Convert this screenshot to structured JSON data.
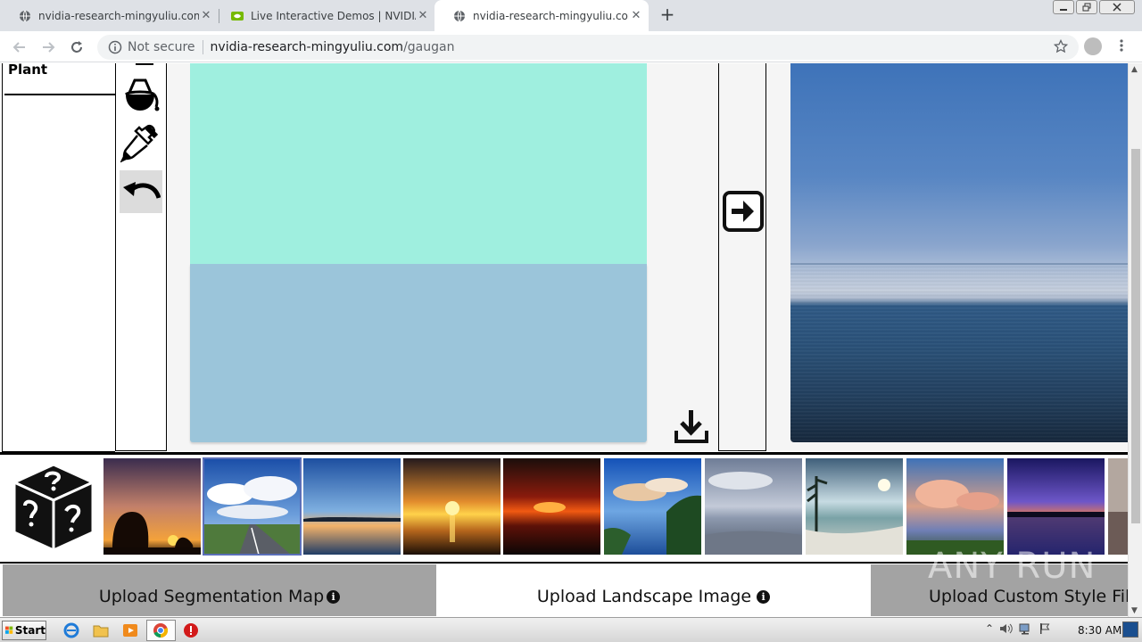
{
  "browser": {
    "tabs": [
      {
        "label": "nvidia-research-mingyuliu.com",
        "close": "✕",
        "active": false
      },
      {
        "label": "Live Interactive Demos | NVIDIA Res",
        "close": "✕",
        "active": false
      },
      {
        "label": "nvidia-research-mingyuliu.com",
        "close": "✕",
        "active": true
      }
    ],
    "new_tab": "+",
    "security_text": "Not secure",
    "url_host": "nvidia-research-mingyuliu.com",
    "url_path": "/gaugan"
  },
  "page": {
    "label_panel": {
      "current_label": "Plant"
    },
    "tools": [
      "brush-icon",
      "fill-bucket-icon",
      "eyedropper-icon",
      "undo-icon"
    ],
    "segmentation_colors": {
      "sky": "#9fefdf",
      "sea": "#9bc5da"
    },
    "gallery": {
      "thumbnails": [
        {
          "name": "sunset-trees",
          "selected": false
        },
        {
          "name": "road-clouds",
          "selected": true
        },
        {
          "name": "lake-dusk",
          "selected": false
        },
        {
          "name": "golden-sunset-sea",
          "selected": false
        },
        {
          "name": "red-sunset",
          "selected": false
        },
        {
          "name": "cliff-coast",
          "selected": false
        },
        {
          "name": "cloudy-beach",
          "selected": false
        },
        {
          "name": "palm-beach",
          "selected": false
        },
        {
          "name": "pink-clouds-lake",
          "selected": false
        },
        {
          "name": "purple-night-lake",
          "selected": false
        },
        {
          "name": "partial-thumbnail",
          "selected": false
        }
      ]
    },
    "uploads": [
      {
        "label": "Upload Segmentation Map",
        "info": "i"
      },
      {
        "label": "Upload Landscape Image",
        "info": "i"
      },
      {
        "label": "Upload Custom Style Filte",
        "info": ""
      }
    ]
  },
  "watermark": "ANY RUN",
  "taskbar": {
    "start_label": "Start",
    "clock": "8:30 AM"
  }
}
